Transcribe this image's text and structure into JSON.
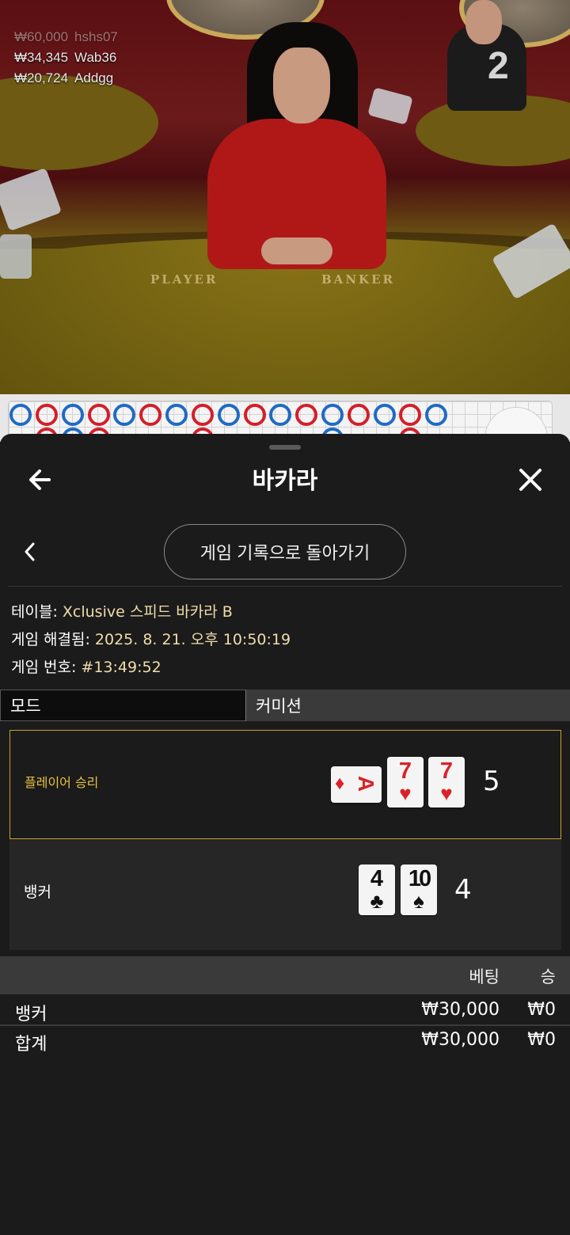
{
  "stream": {
    "bets": [
      {
        "amount": "₩60,000",
        "user": "hshs07"
      },
      {
        "amount": "₩34,345",
        "user": "Wab36"
      },
      {
        "amount": "₩20,724",
        "user": "Addgg"
      }
    ],
    "table_number": "2",
    "table_labels": {
      "player": "PLAYER",
      "banker": "BANKER"
    }
  },
  "header": {
    "title": "바카라",
    "back_icon": "arrow-left-icon",
    "close_icon": "close-icon"
  },
  "subnav": {
    "back_icon": "chevron-left-icon",
    "return_label": "게임 기록으로 돌아가기"
  },
  "info": {
    "table_key": "테이블:",
    "table_value": "Xclusive 스피드 바카라 B",
    "resolved_key": "게임 해결됨:",
    "resolved_value": "2025. 8. 21. 오후 10:50:19",
    "number_key": "게임 번호:",
    "number_value": "#13:49:52"
  },
  "tabs": [
    {
      "label": "모드",
      "active": true
    },
    {
      "label": "커미션",
      "active": false
    }
  ],
  "results": {
    "player": {
      "label": "플레이어 승리",
      "score": "5",
      "cards": [
        {
          "rank": "A",
          "suit": "♦",
          "color": "red",
          "sideways": true
        },
        {
          "rank": "7",
          "suit": "♥",
          "color": "red"
        },
        {
          "rank": "7",
          "suit": "♥",
          "color": "red"
        }
      ]
    },
    "banker": {
      "label": "뱅커",
      "score": "4",
      "cards": [
        {
          "rank": "4",
          "suit": "♣",
          "color": "black"
        },
        {
          "rank": "10",
          "suit": "♠",
          "color": "black"
        }
      ]
    },
    "win_border_color": "#c9a227"
  },
  "bets_table": {
    "headers": {
      "bet": "베팅",
      "win": "승"
    },
    "rows": [
      {
        "name": "뱅커",
        "bet": "₩30,000",
        "win": "₩0"
      },
      {
        "name": "합계",
        "bet": "₩30,000",
        "win": "₩0"
      }
    ]
  },
  "colors": {
    "accent_gold": "#e7c340",
    "info_value": "#f1ddab",
    "player_blue": "#1f6ac4",
    "banker_red": "#d21f2b"
  }
}
